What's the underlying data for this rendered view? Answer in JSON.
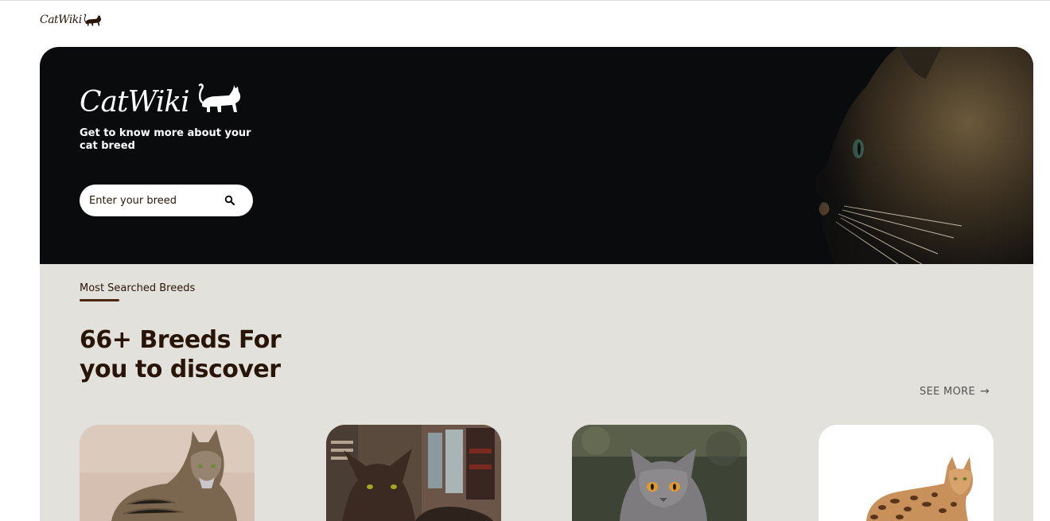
{
  "brand": {
    "name": "CatWiki",
    "icon": "cat-silhouette-icon",
    "color": "#291507"
  },
  "hero": {
    "logo_text": "CatWiki",
    "tagline": "Get to know more about your cat breed",
    "search": {
      "placeholder": "Enter your breed",
      "value": "",
      "icon": "search-icon"
    },
    "background_color": "#0a0b0d"
  },
  "breeds_section": {
    "label": "Most Searched Breeds",
    "headline": "66+ Breeds For you to discover",
    "see_more": "SEE MORE",
    "see_more_icon": "arrow-right-icon",
    "background_color": "#e3e1dc",
    "accent_color": "#4d270c",
    "cards": [
      {
        "image": "maine-coon-cat-photo"
      },
      {
        "image": "havana-brown-cat-photo"
      },
      {
        "image": "british-shorthair-cat-photo"
      },
      {
        "image": "bengal-cat-photo"
      }
    ]
  }
}
